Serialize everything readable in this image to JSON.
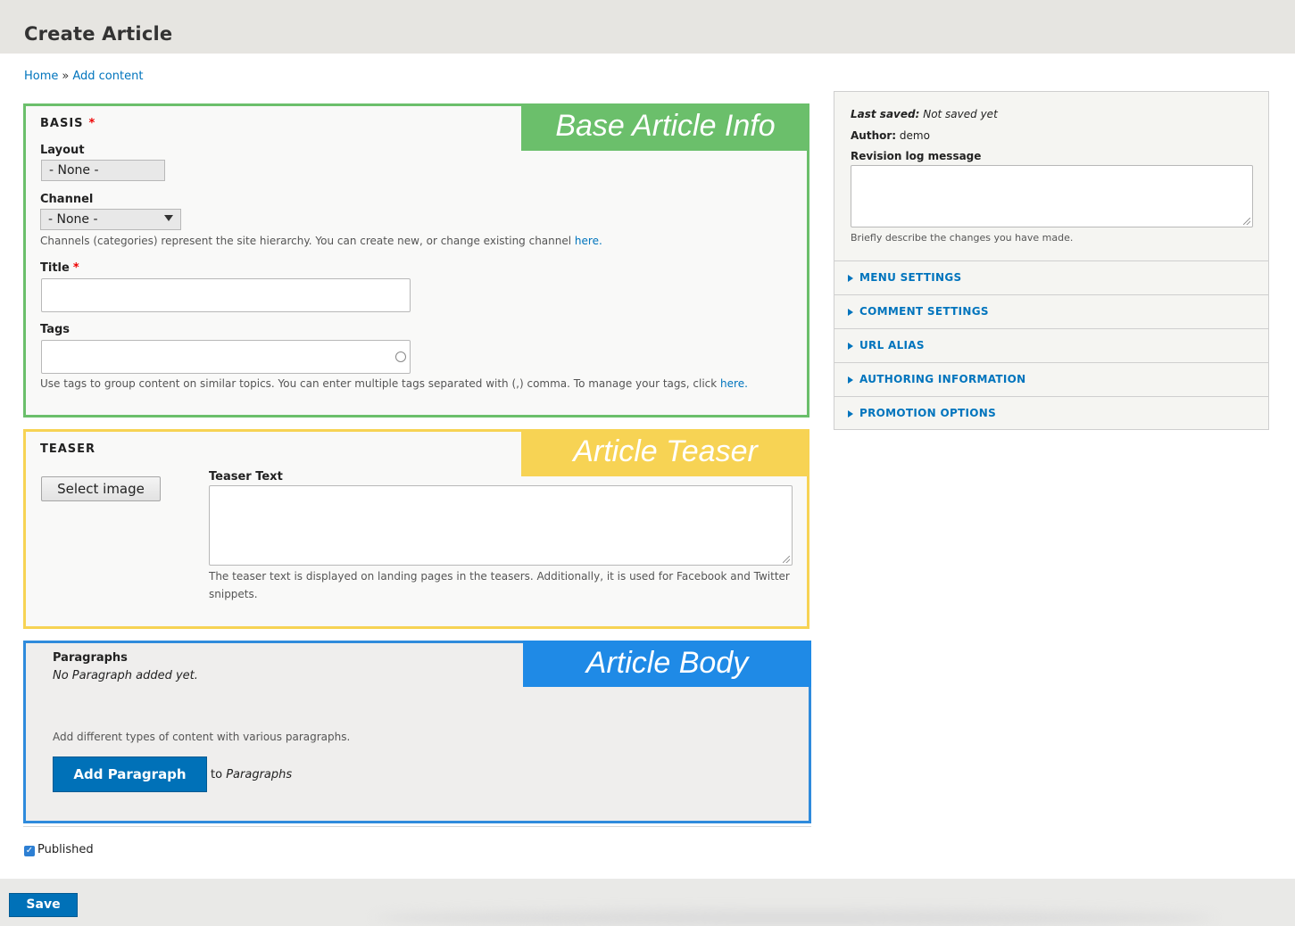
{
  "page": {
    "title": "Create Article"
  },
  "breadcrumb": {
    "home": "Home",
    "separator": "»",
    "add_content": "Add content"
  },
  "basis": {
    "legend": "BASIS",
    "required_mark": "*",
    "flag": "Base Article Info",
    "layout": {
      "label": "Layout",
      "value": "- None -"
    },
    "channel": {
      "label": "Channel",
      "value": "- None -",
      "description": "Channels (categories) represent the site hierarchy. You can create new, or change existing channel",
      "link": "here."
    },
    "title_field": {
      "label": "Title",
      "required_mark": "*",
      "value": ""
    },
    "tags": {
      "label": "Tags",
      "value": "",
      "description": "Use tags to group content on similar topics. You can enter multiple tags separated with (,) comma. To manage your tags, click",
      "link": "here."
    }
  },
  "teaser": {
    "legend": "TEASER",
    "flag": "Article Teaser",
    "select_image": "Select image",
    "text_label": "Teaser Text",
    "text_value": "",
    "description_line1": "The teaser text is displayed on landing pages in the teasers. Additionally, it is used for Facebook and Twitter",
    "description_line2": "snippets."
  },
  "body": {
    "flag": "Article Body",
    "label": "Paragraphs",
    "empty": "No Paragraph added yet.",
    "hint": "Add different types of content with various paragraphs.",
    "add_button": "Add Paragraph",
    "to": "to",
    "target": "Paragraphs"
  },
  "sidebar": {
    "last_saved_label": "Last saved:",
    "last_saved_value": "Not saved yet",
    "author_label": "Author:",
    "author_value": "demo",
    "revision_label": "Revision log message",
    "revision_value": "",
    "revision_description": "Briefly describe the changes you have made.",
    "sections": [
      "MENU SETTINGS",
      "COMMENT SETTINGS",
      "URL ALIAS",
      "AUTHORING INFORMATION",
      "PROMOTION OPTIONS"
    ]
  },
  "published": {
    "label": "Published",
    "checked": true
  },
  "save": "Save"
}
